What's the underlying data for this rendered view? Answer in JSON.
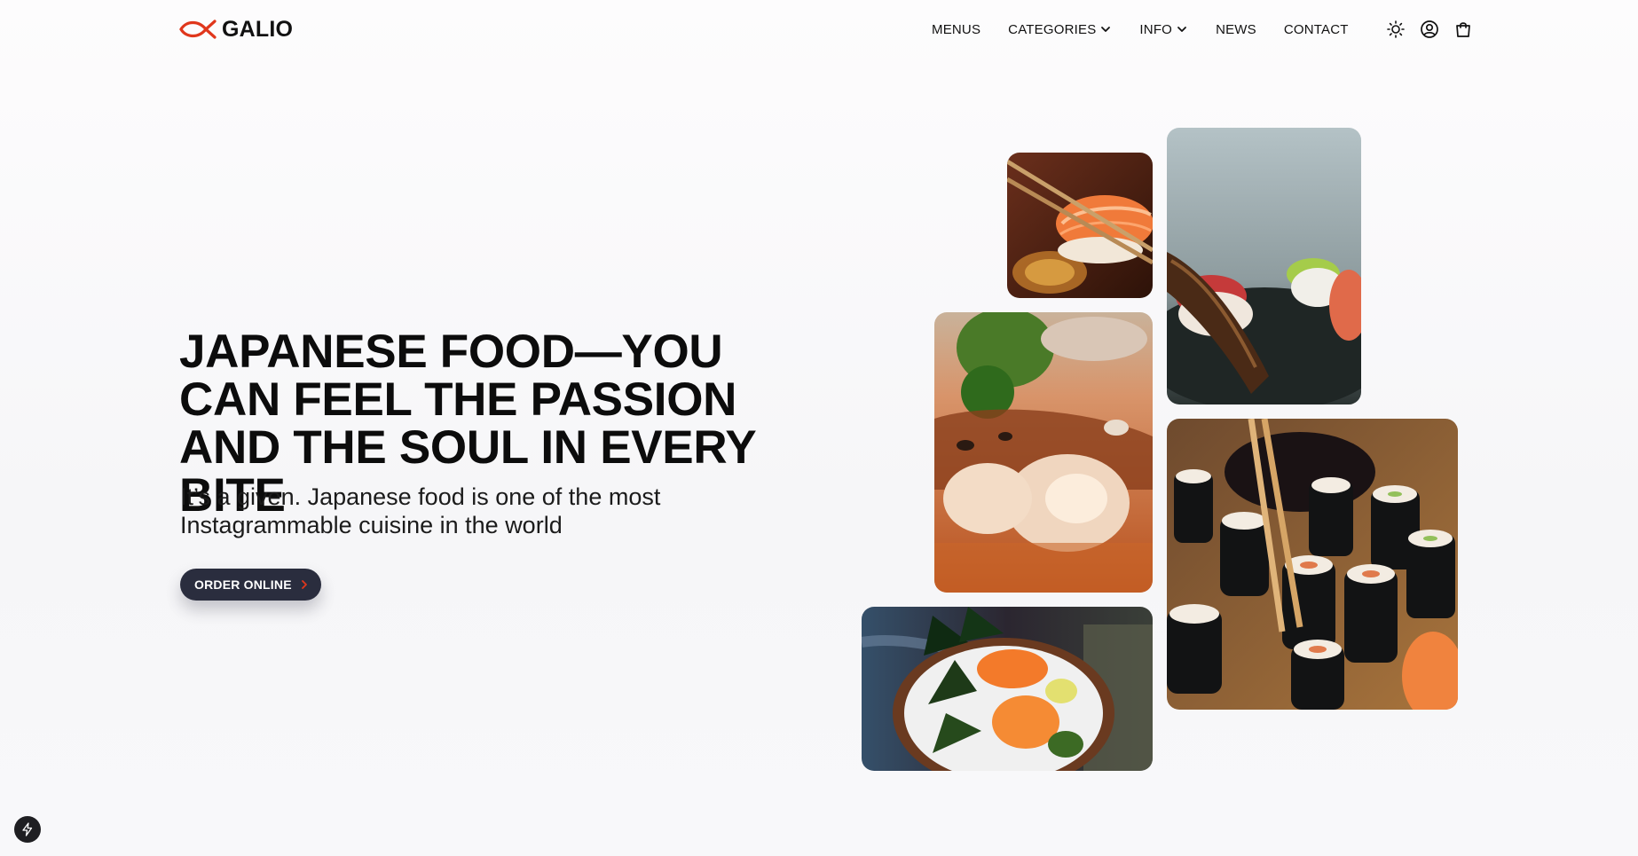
{
  "brand": {
    "name": "GALIO",
    "accent_color": "#e0371c"
  },
  "nav": {
    "items": [
      {
        "label": "MENUS",
        "has_dropdown": false
      },
      {
        "label": "CATEGORIES",
        "has_dropdown": true
      },
      {
        "label": "INFO",
        "has_dropdown": true
      },
      {
        "label": "NEWS",
        "has_dropdown": false
      },
      {
        "label": "CONTACT",
        "has_dropdown": false
      }
    ],
    "icons": [
      "sun-icon",
      "user-icon",
      "shopping-bag-icon"
    ]
  },
  "hero": {
    "title": "JAPANESE FOOD—YOU CAN FEEL THE PASSION AND THE SOUL IN EVERY BITE",
    "subtitle": "It’s a given. Japanese food is one of the most Instagrammable cuisine in the world",
    "cta_label": "ORDER ONLINE",
    "cta_color": "#2a2d3e"
  },
  "gallery": {
    "images": [
      "salmon-nigiri-chopsticks-photo",
      "sushi-plate-closeup-photo",
      "shrimp-sushi-macro-photo",
      "maki-rolls-chopsticks-photo",
      "sashimi-bowl-photo"
    ]
  },
  "floating_action": {
    "icon": "lightning-bolt-icon"
  }
}
